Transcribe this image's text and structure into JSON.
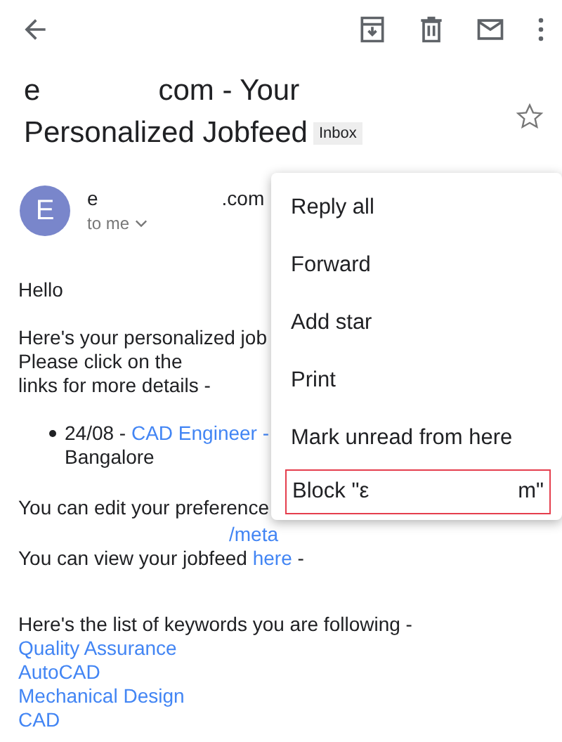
{
  "subject": {
    "start": "e",
    "rest": "com - Your",
    "line2": "Personalized Jobfeed",
    "label": "Inbox",
    "starred": false
  },
  "sender": {
    "initial": "E",
    "name_start": "e",
    "name_end": ".com",
    "recipient": "to me"
  },
  "body": {
    "greeting": "Hello",
    "intro": [
      "Here's your personalized job",
      "Please click on the",
      "links for more details -"
    ],
    "job": {
      "date": "24/08 -",
      "link": "CAD Engineer -",
      "location": "Bangalore"
    },
    "edit_text": "You can edit your preference",
    "edit_link": "/meta",
    "view_text": "You can view your jobfeed",
    "view_link": "here",
    "view_after": "-",
    "keywords_title": "Here's the list of keywords you are following -",
    "keywords": [
      "Quality Assurance",
      "AutoCAD",
      "Mechanical Design",
      "CAD"
    ]
  },
  "menu": [
    {
      "label": "Reply all",
      "selected": false
    },
    {
      "label": "Forward",
      "selected": false
    },
    {
      "label": "Add star",
      "selected": false
    },
    {
      "label": "Print",
      "selected": false
    },
    {
      "label": "Mark unread from here",
      "selected": false
    },
    {
      "label": "Block \"ε",
      "label_end": "m\"",
      "selected": true
    }
  ]
}
